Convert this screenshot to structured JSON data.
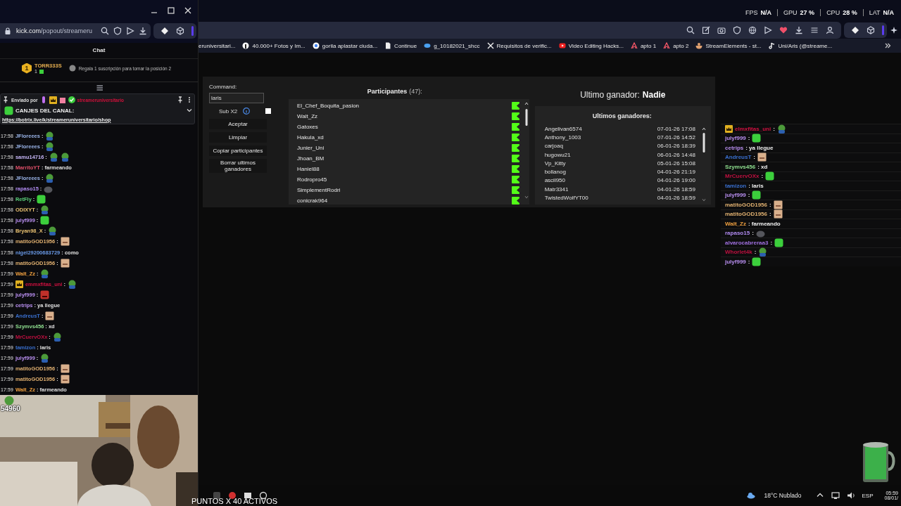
{
  "browser": {
    "url_host": "kick.com",
    "url_path": "/popout/streameru"
  },
  "chat": {
    "title": "Chat",
    "top_gifter": {
      "rank": "1",
      "name": "TORR333S",
      "count": "1",
      "prompt": "Regala 1 suscripción para tomar la posición 2"
    },
    "pinned": {
      "label": "Enviado por",
      "author": "streameruniversitario",
      "title": "CANJES DEL CANAL:",
      "link": "https://botrix.live/k/streameruniversitario/shop"
    },
    "messages": [
      {
        "time": "17:58",
        "user": "JFloreees",
        "color": "#9ab4e8",
        "text": ":",
        "emotes": [
          {
            "kind": "frog"
          }
        ]
      },
      {
        "time": "17:58",
        "user": "JFloreees",
        "color": "#9ab4e8",
        "text": ":",
        "emotes": [
          {
            "kind": "frog"
          }
        ]
      },
      {
        "time": "17:58",
        "user": "samu14716",
        "color": "#c4b4f4",
        "text": ":",
        "emotes": [
          {
            "kind": "frog"
          },
          {
            "kind": "frog"
          }
        ]
      },
      {
        "time": "17:58",
        "user": "MarritoYT",
        "color": "#e0506a",
        "text": ": farmeando"
      },
      {
        "time": "17:58",
        "user": "JFloreees",
        "color": "#9ab4e8",
        "text": ":",
        "emotes": [
          {
            "kind": "frog"
          }
        ]
      },
      {
        "time": "17:58",
        "user": "rapaso15",
        "color": "#b08af0",
        "text": ":",
        "emotes": [
          {
            "kind": "gray"
          }
        ]
      },
      {
        "time": "17:58",
        "user": "RetFly",
        "color": "#5ad07a",
        "text": ":",
        "emotes": [
          {
            "kind": "green"
          }
        ]
      },
      {
        "time": "17:58",
        "user": "ODIXYT",
        "color": "#e8c070",
        "text": ":",
        "emotes": [
          {
            "kind": "frog"
          }
        ]
      },
      {
        "time": "17:58",
        "user": "julyf999",
        "color": "#b98ff0",
        "text": ":",
        "emotes": [
          {
            "kind": "green"
          }
        ]
      },
      {
        "time": "17:58",
        "user": "Bryan98_X",
        "color": "#e8c070",
        "text": ":",
        "emotes": [
          {
            "kind": "frog"
          }
        ]
      },
      {
        "time": "17:58",
        "user": "matitoGOD1956",
        "color": "#e0b070",
        "text": ":",
        "emotes": [
          {
            "kind": "face"
          }
        ]
      },
      {
        "time": "17:58",
        "user": "nigel29200683729",
        "color": "#6a9ae8",
        "text": ": como"
      },
      {
        "time": "17:58",
        "user": "matitoGOD1956",
        "color": "#e0b070",
        "text": ":",
        "emotes": [
          {
            "kind": "face"
          }
        ]
      },
      {
        "time": "17:59",
        "user": "Walt_Zz",
        "color": "#f0a040",
        "text": ":",
        "emotes": [
          {
            "kind": "frog"
          }
        ]
      },
      {
        "time": "17:59",
        "user": "emmxfitas_uni",
        "color": "#d01040",
        "badges": [
          {
            "kind": "crown"
          }
        ],
        "text": ":",
        "emotes": [
          {
            "kind": "frog"
          }
        ]
      },
      {
        "time": "17:59",
        "user": "julyf999",
        "color": "#b98ff0",
        "text": ":",
        "emotes": [
          {
            "kind": "angry"
          }
        ]
      },
      {
        "time": "17:59",
        "user": "cetrips",
        "color": "#b98ff0",
        "text": ": ya llegue"
      },
      {
        "time": "17:59",
        "user": "AndreusT",
        "color": "#3a70d0",
        "text": ":",
        "emotes": [
          {
            "kind": "face"
          }
        ]
      },
      {
        "time": "17:59",
        "user": "Szymvs456",
        "color": "#90e090",
        "text": ": xd"
      },
      {
        "time": "17:59",
        "user": "MrCuervOXx",
        "color": "#c01040",
        "text": ":",
        "emotes": [
          {
            "kind": "frog"
          }
        ]
      },
      {
        "time": "17:59",
        "user": "tamizon",
        "color": "#3a70d0",
        "text": ": laris"
      },
      {
        "time": "17:59",
        "user": "julyf999",
        "color": "#b98ff0",
        "text": ":",
        "emotes": [
          {
            "kind": "frog"
          }
        ]
      },
      {
        "time": "17:59",
        "user": "matitoGOD1956",
        "color": "#e0b070",
        "text": ":",
        "emotes": [
          {
            "kind": "face"
          }
        ]
      },
      {
        "time": "17:59",
        "user": "matitoGOD1956",
        "color": "#e0b070",
        "text": ":",
        "emotes": [
          {
            "kind": "face"
          }
        ]
      },
      {
        "time": "17:59",
        "user": "Walt_Zz",
        "color": "#f0a040",
        "text": ": farmeando"
      }
    ]
  },
  "webcam": {
    "kind": "picture",
    "overlay": "54960"
  },
  "stats": [
    {
      "label": "FPS",
      "value": "N/A"
    },
    {
      "label": "GPU",
      "value": "27 %"
    },
    {
      "label": "CPU",
      "value": "28 %"
    },
    {
      "label": "LAT",
      "value": "N/A"
    }
  ],
  "bookmarks": [
    {
      "label": "eruniversitari...",
      "kind": "none"
    },
    {
      "label": "40.000+ Fotos y Im...",
      "kind": "pin"
    },
    {
      "label": "gorila aplastar ciuda...",
      "kind": "google"
    },
    {
      "label": "Continue",
      "kind": "doc"
    },
    {
      "label": "g_10182021_shcc",
      "kind": "drop"
    },
    {
      "label": "Requisitos de verific...",
      "kind": "x"
    },
    {
      "label": "Video Editing Hacks...",
      "kind": "video"
    },
    {
      "label": "apto 1",
      "kind": "arch"
    },
    {
      "label": "apto 2",
      "kind": "arch"
    },
    {
      "label": "StreamElements - st...",
      "kind": "bowl"
    },
    {
      "label": "Uni/Aris (@streame...",
      "kind": "note"
    }
  ],
  "app": {
    "command_label": "Command:",
    "command_value": "laris",
    "sub_label": "Sub X2",
    "sub_checked": false,
    "buttons": [
      "Aceptar",
      "Limpiar",
      "Copiar participantes",
      "Borrar ultimos ganadores"
    ],
    "participants_title": "Participantes",
    "participants_count": "(47):",
    "participants": [
      "El_Chef_Boquita_pasion",
      "Walt_Zz",
      "Gatoxes",
      "Hakula_xd",
      "Junier_Uni",
      "Jhoan_BM",
      "Haniel88",
      "Rodropro45",
      "SimplementRodri",
      "conicrak964"
    ],
    "last_winner_label": "Ultimo ganador:",
    "last_winner": "Nadie",
    "winners_title": "Ultimos ganadores:",
    "winners": [
      {
        "name": "Angelivan6574",
        "date": "07-01-26 17:08"
      },
      {
        "name": "Anthony_1003",
        "date": "07-01-26 14:52"
      },
      {
        "name": "carjoaq",
        "date": "06-01-26 18:39"
      },
      {
        "name": "hugowu21",
        "date": "06-01-26 14:48"
      },
      {
        "name": "Vp_Kitty",
        "date": "05-01-26 15:08"
      },
      {
        "name": "bollanog",
        "date": "04-01-26 21:19"
      },
      {
        "name": "ascil950",
        "date": "04-01-26 19:00"
      },
      {
        "name": "Matr3341",
        "date": "04-01-26 18:59"
      },
      {
        "name": "TwistedWolfYT00",
        "date": "04-01-26 18:59"
      }
    ]
  },
  "overlay_chat": [
    {
      "user": "elmxfitas_uni",
      "color": "#d01040",
      "badges": [
        {
          "kind": "crown"
        }
      ],
      "text": ":",
      "emotes": [
        {
          "kind": "frog"
        }
      ]
    },
    {
      "user": "julyf999",
      "color": "#b98ff0",
      "text": ":",
      "emotes": [
        {
          "kind": "green"
        }
      ]
    },
    {
      "user": "cetrips",
      "color": "#b98ff0",
      "text": ": ya llegue"
    },
    {
      "user": "AndreusT",
      "color": "#3a70d0",
      "text": ":",
      "emotes": [
        {
          "kind": "face"
        }
      ]
    },
    {
      "user": "Szymvs456",
      "color": "#90e090",
      "text": ": xd"
    },
    {
      "user": "MrCuervOXx",
      "color": "#c01040",
      "text": ":",
      "emotes": [
        {
          "kind": "green"
        }
      ]
    },
    {
      "user": "tamizon",
      "color": "#3a70d0",
      "text": ": laris"
    },
    {
      "user": "julyf999",
      "color": "#b98ff0",
      "text": ":",
      "emotes": [
        {
          "kind": "green"
        }
      ]
    },
    {
      "user": "matitoGOD1956",
      "color": "#e0b070",
      "text": ":",
      "emotes": [
        {
          "kind": "face"
        }
      ]
    },
    {
      "user": "matitoGOD1956",
      "color": "#e0b070",
      "text": ":",
      "emotes": [
        {
          "kind": "face"
        }
      ]
    },
    {
      "user": "Walt_Zz",
      "color": "#f0a040",
      "text": ": farmeando"
    },
    {
      "user": "rapaso15",
      "color": "#b08af0",
      "text": ":",
      "emotes": [
        {
          "kind": "gray"
        }
      ]
    },
    {
      "user": "alvarocabreraa3",
      "color": "#a070e0",
      "text": ":",
      "emotes": [
        {
          "kind": "green"
        }
      ]
    },
    {
      "user": "Whorlet4k",
      "color": "#c01040",
      "text": ":",
      "emotes": [
        {
          "kind": "frog"
        }
      ]
    },
    {
      "user": "julyf999",
      "color": "#b98ff0",
      "text": ":",
      "emotes": [
        {
          "kind": "green"
        }
      ]
    }
  ],
  "taskbar": {
    "ticker": "PUNTOS X 40 ACTIVOS",
    "weather": "18°C Nublado",
    "language": "ESP",
    "time": "05:59",
    "date": "08/01/"
  }
}
